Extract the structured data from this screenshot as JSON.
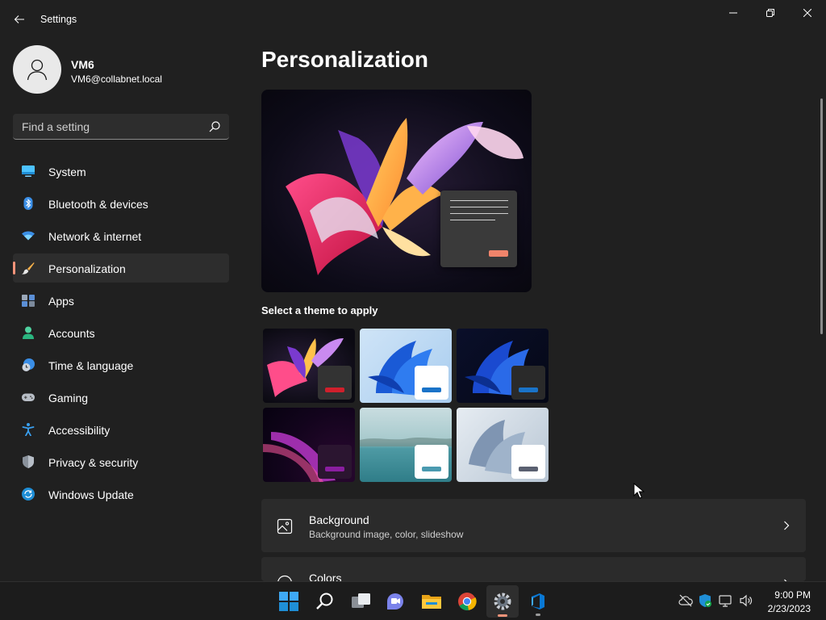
{
  "window": {
    "title": "Settings",
    "icons": {
      "back": "back-arrow-icon",
      "minimize": "minimize-icon",
      "restore": "restore-icon",
      "close": "close-icon"
    }
  },
  "profile": {
    "name": "VM6",
    "email": "VM6@collabnet.local"
  },
  "search": {
    "placeholder": "Find a setting"
  },
  "sidebar": {
    "items": [
      {
        "label": "System",
        "icon": "monitor-icon",
        "active": false
      },
      {
        "label": "Bluetooth & devices",
        "icon": "bluetooth-icon",
        "active": false
      },
      {
        "label": "Network & internet",
        "icon": "wifi-icon",
        "active": false
      },
      {
        "label": "Personalization",
        "icon": "paintbrush-icon",
        "active": true
      },
      {
        "label": "Apps",
        "icon": "apps-icon",
        "active": false
      },
      {
        "label": "Accounts",
        "icon": "person-icon",
        "active": false
      },
      {
        "label": "Time & language",
        "icon": "clock-globe-icon",
        "active": false
      },
      {
        "label": "Gaming",
        "icon": "gamepad-icon",
        "active": false
      },
      {
        "label": "Accessibility",
        "icon": "accessibility-icon",
        "active": false
      },
      {
        "label": "Privacy & security",
        "icon": "shield-icon",
        "active": false
      },
      {
        "label": "Windows Update",
        "icon": "update-icon",
        "active": false
      }
    ]
  },
  "main": {
    "title": "Personalization",
    "theme_heading": "Select a theme to apply",
    "themes": [
      {
        "name": "glow-dark",
        "accent": "#d0202c"
      },
      {
        "name": "bloom-light",
        "accent": "#1a73c8"
      },
      {
        "name": "bloom-dark",
        "accent": "#1a73c8"
      },
      {
        "name": "captured-motion",
        "accent": "#8a1ea0"
      },
      {
        "name": "lake",
        "accent": "#4a9ab0"
      },
      {
        "name": "flow",
        "accent": "#5a6070"
      }
    ],
    "cards": [
      {
        "title": "Background",
        "subtitle": "Background image, color, slideshow",
        "icon": "image-icon"
      },
      {
        "title": "Colors",
        "subtitle": "",
        "icon": "palette-icon"
      }
    ]
  },
  "taskbar": {
    "apps": [
      "start-icon",
      "search-icon",
      "task-view-icon",
      "chat-icon",
      "file-explorer-icon",
      "chrome-icon",
      "settings-icon",
      "azure-devops-icon"
    ],
    "tray": [
      "cloud-offline-icon",
      "security-shield-icon",
      "network-icon",
      "volume-icon"
    ],
    "time": "9:00 PM",
    "date": "2/23/2023"
  },
  "colors": {
    "accent": "#f7947a",
    "background": "#202020",
    "card": "#2b2b2b"
  }
}
